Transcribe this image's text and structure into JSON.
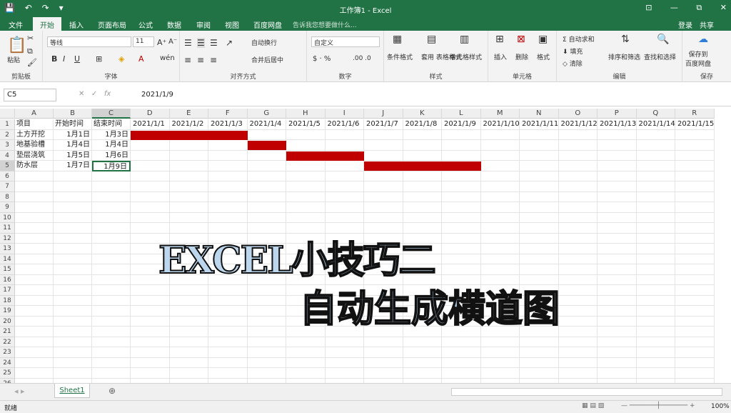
{
  "titlebar": {
    "title": "工作簿1 - Excel",
    "qat": [
      "💾",
      "↶",
      "↷",
      "▾"
    ],
    "win": [
      "⊡",
      "—",
      "⧉",
      "✕"
    ]
  },
  "tabs": {
    "items": [
      "文件",
      "开始",
      "插入",
      "页面布局",
      "公式",
      "数据",
      "审阅",
      "视图",
      "百度网盘"
    ],
    "active": "开始",
    "tell_me": "告诉我您想要做什么...",
    "login": "登录",
    "share": "共享"
  },
  "ribbon": {
    "clipboard": {
      "paste": "粘贴",
      "label": "剪贴板"
    },
    "font": {
      "name": "等线",
      "size": "11",
      "bold": "B",
      "italic": "I",
      "underline": "U",
      "label": "字体"
    },
    "align": {
      "wrap": "自动换行",
      "merge": "合并后居中",
      "label": "对齐方式"
    },
    "number": {
      "format": "自定义",
      "label": "数字"
    },
    "styles": {
      "cond": "条件格式",
      "table": "套用\n表格格式",
      "cell": "单元格样式",
      "label": "样式"
    },
    "cells": {
      "insert": "插入",
      "delete": "删除",
      "format": "格式",
      "label": "单元格"
    },
    "edit": {
      "autosum": "自动求和",
      "fill": "填充",
      "clear": "清除",
      "sort": "排序和筛选",
      "find": "查找和选择",
      "label": "编辑"
    },
    "save": {
      "save": "保存到\n百度网盘",
      "label": "保存"
    }
  },
  "formula": {
    "name_box": "C5",
    "fx": "fx",
    "value": "2021/1/9"
  },
  "columns": [
    "A",
    "B",
    "C",
    "D",
    "E",
    "F",
    "G",
    "H",
    "I",
    "J",
    "K",
    "L",
    "M",
    "N",
    "O",
    "P",
    "Q",
    "R"
  ],
  "dates": [
    "2021/1/1",
    "2021/1/2",
    "2021/1/3",
    "2021/1/4",
    "2021/1/5",
    "2021/1/6",
    "2021/1/7",
    "2021/1/8",
    "2021/1/9",
    "2021/1/10",
    "2021/1/11",
    "2021/1/12",
    "2021/1/13",
    "2021/1/14",
    "2021/1/15"
  ],
  "headers": [
    "项目",
    "开始时间",
    "结束时间"
  ],
  "tasks": [
    {
      "name": "土方开挖",
      "start": "1月1日",
      "end": "1月3日",
      "s": 1,
      "e": 3
    },
    {
      "name": "地基验槽",
      "start": "1月4日",
      "end": "1月4日",
      "s": 4,
      "e": 4
    },
    {
      "name": "垫层浇筑",
      "start": "1月5日",
      "end": "1月6日",
      "s": 5,
      "e": 6
    },
    {
      "name": "防水层",
      "start": "1月7日",
      "end": "1月9日",
      "s": 7,
      "e": 9
    }
  ],
  "bar_color": "#c00000",
  "overlay": {
    "line1": "EXCEL小技巧二",
    "line2": "自动生成横道图"
  },
  "sheet": {
    "tab": "Sheet1",
    "add": "⊕"
  },
  "status": {
    "ready": "就绪",
    "zoom": "100%"
  }
}
